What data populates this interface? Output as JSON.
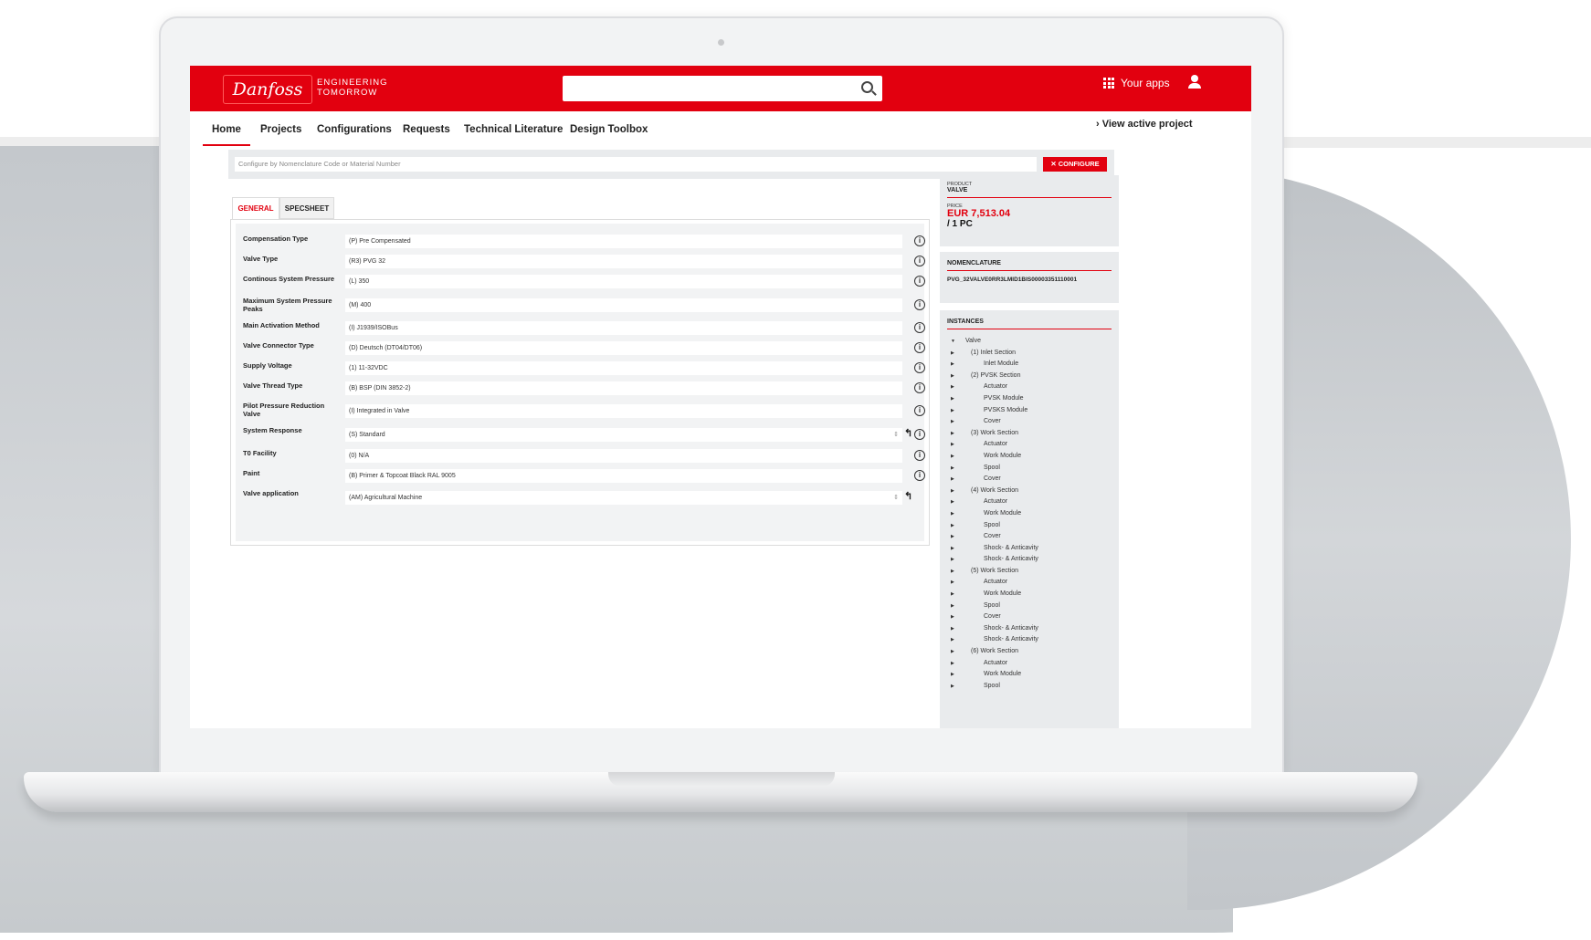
{
  "brand": {
    "logo_text": "Danfoss",
    "tagline_1": "ENGINEERING",
    "tagline_2": "TOMORROW",
    "accent": "#e2000f"
  },
  "topbar": {
    "search_placeholder": "",
    "your_apps": "Your apps",
    "icons": [
      "search-icon",
      "apps-grid-icon",
      "user-icon"
    ]
  },
  "nav": {
    "items": [
      "Home",
      "Projects",
      "Configurations",
      "Requests",
      "Technical Literature",
      "Design Toolbox"
    ],
    "active": "Home",
    "view_active_project": "› View active project"
  },
  "configure": {
    "placeholder": "Configure by Nomenclature Code or Material Number",
    "button": "CONFIGURE"
  },
  "tabs": {
    "general": "GENERAL",
    "specsheet": "SPECSHEET",
    "active": "GENERAL"
  },
  "form": {
    "rows": [
      {
        "label": "Compensation Type",
        "value": "(P) Pre Compensated"
      },
      {
        "label": "Valve Type",
        "value": "(R3) PVG 32"
      },
      {
        "label": "Continous System Pressure",
        "value": "(L) 350"
      },
      {
        "label": "Maximum System Pressure Peaks",
        "value": "(M) 400"
      },
      {
        "label": "Main Activation Method",
        "value": "(I) J1939/ISOBus"
      },
      {
        "label": "Valve Connector Type",
        "value": "(D) Deutsch (DT04/DT06)"
      },
      {
        "label": "Supply Voltage",
        "value": "(1) 11-32VDC"
      },
      {
        "label": "Valve Thread Type",
        "value": "(B) BSP (DIN 3852-2)"
      },
      {
        "label": "Pilot Pressure Reduction Valve",
        "value": "(I) Integrated in Valve"
      },
      {
        "label": "System Response",
        "value": "(S) Standard"
      },
      {
        "label": "T0 Facility",
        "value": "(0) N/A"
      },
      {
        "label": "Paint",
        "value": "(B) Primer & Topcoat Black RAL 9005"
      },
      {
        "label": "Valve application",
        "value": "(AM) Agricultural Machine"
      }
    ]
  },
  "product": {
    "product_label": "PRODUCT",
    "product_value": "VALVE",
    "price_label": "PRICE",
    "price": "EUR 7,513.04",
    "unit": "/ 1 PC"
  },
  "nomenclature": {
    "title": "NOMENCLATURE",
    "code": "PVG_32VALVE0RR3LMID1BIS00003351110001"
  },
  "instances": {
    "title": "INSTANCES",
    "items": [
      "Valve",
      "(1) Inlet Section",
      "Inlet Module",
      "(2) PVSK Section",
      "Actuator",
      "PVSK Module",
      "PVSKS Module",
      "Cover",
      "(3) Work Section",
      "Actuator",
      "Work Module",
      "Spool",
      "Cover",
      "(4) Work Section",
      "Actuator",
      "Work Module",
      "Spool",
      "Cover",
      "Shock- & Anticavity",
      "Shock- & Anticavity",
      "(5) Work Section",
      "Actuator",
      "Work Module",
      "Spool",
      "Cover",
      "Shock- & Anticavity",
      "Shock- & Anticavity",
      "(6) Work Section",
      "Actuator",
      "Work Module",
      "Spool"
    ]
  }
}
